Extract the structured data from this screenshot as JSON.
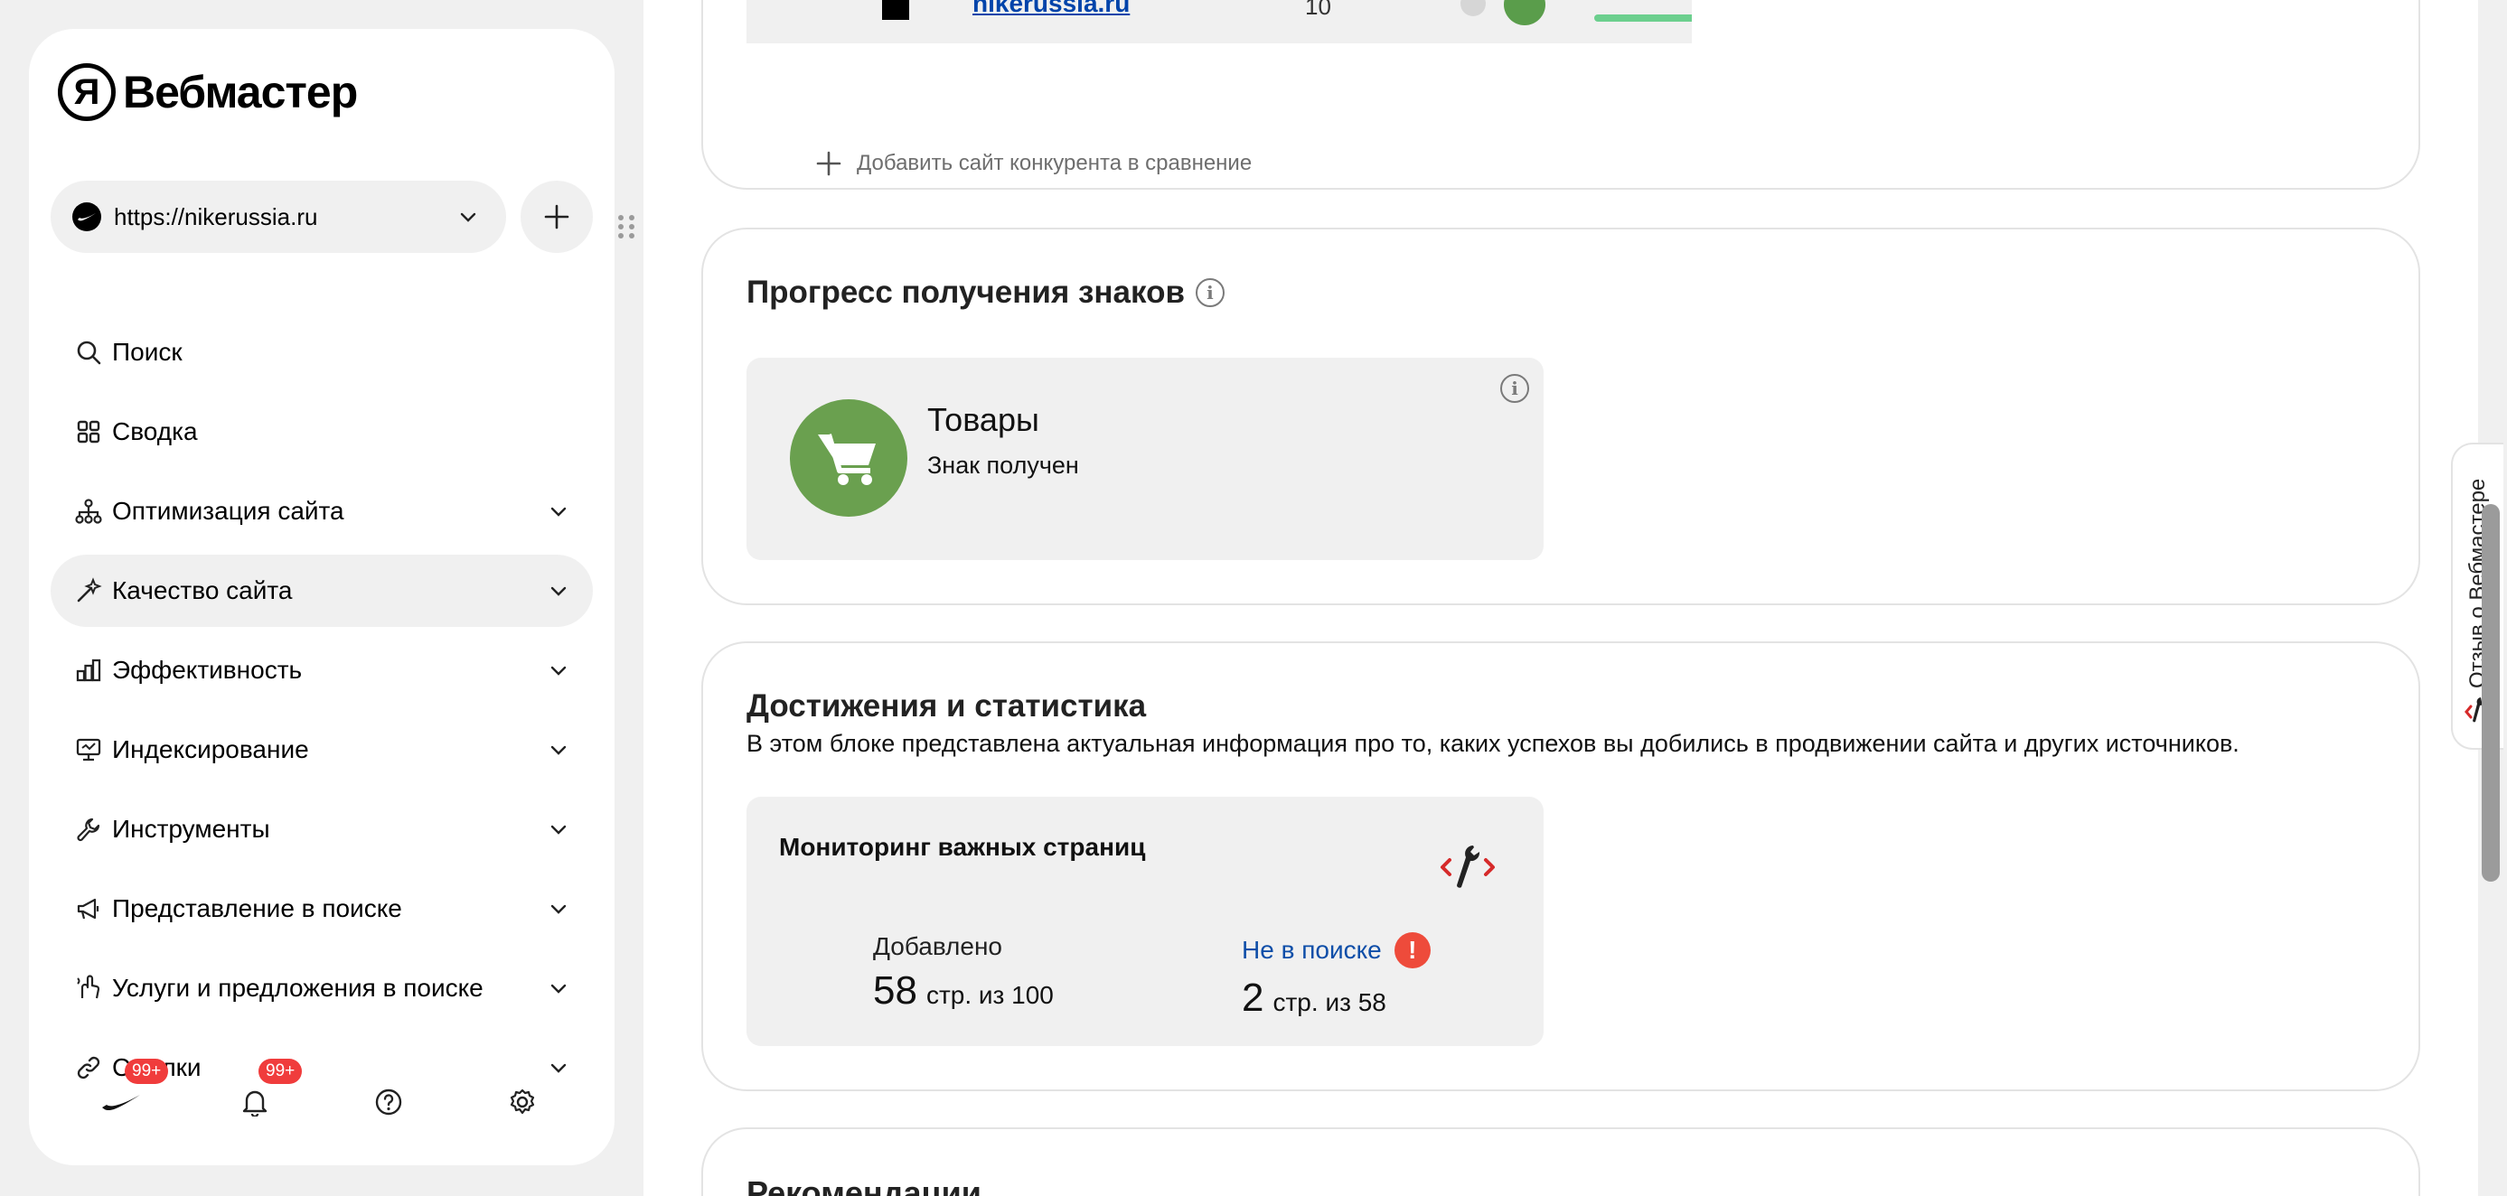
{
  "app": {
    "logo_letter": "Я",
    "title": "Вебмастер"
  },
  "site_selector": {
    "url": "https://nikerussia.ru"
  },
  "nav": {
    "items": [
      {
        "label": "Поиск"
      },
      {
        "label": "Сводка"
      },
      {
        "label": "Оптимизация сайта"
      },
      {
        "label": "Качество сайта"
      },
      {
        "label": "Эффективность"
      },
      {
        "label": "Индексирование"
      },
      {
        "label": "Инструменты"
      },
      {
        "label": "Представление в поиске"
      },
      {
        "label": "Услуги и предложения в поиске"
      },
      {
        "label": "Ссылки"
      }
    ]
  },
  "bottom_bar": {
    "sites_badge": "99+",
    "notifications_badge": "99+"
  },
  "competitors": {
    "row_domain": "nikerussia.ru",
    "row_value": "10",
    "add_label": "Добавить сайт конкурента в сравнение"
  },
  "badges_progress": {
    "title": "Прогресс получения знаков",
    "tile": {
      "title": "Товары",
      "status": "Знак получен"
    }
  },
  "achievements": {
    "title": "Достижения и статистика",
    "description": "В этом блоке представлена актуальная информация про то, каких успехов вы добились в продвижении сайта и других источников.",
    "monitoring": {
      "title": "Мониторинг важных страниц",
      "added_label": "Добавлено",
      "added_count": "58",
      "added_suffix": "стр. из 100",
      "not_in_search_label": "Не в поиске",
      "not_in_search_count": "2",
      "not_in_search_suffix": "стр. из 58"
    }
  },
  "recommendations": {
    "title": "Рекомендации"
  },
  "feedback": {
    "label": "Отзыв о Вебмастере"
  },
  "colors": {
    "page_bg": "#f0f0f0",
    "card_border": "#e3e3e3",
    "badge_green": "#6aa04f",
    "link_blue": "#0e4ea8",
    "alert_red": "#ee4b3b",
    "counter_red": "#f03c3c"
  },
  "icons": {
    "nav": [
      "search-icon",
      "grid-icon",
      "sitemap-icon",
      "magic-wand-icon",
      "chart-icon",
      "monitor-icon",
      "wrench-icon",
      "megaphone-icon",
      "hand-icon",
      "link-icon"
    ],
    "bottom": [
      "swoosh-icon",
      "bell-icon",
      "help-icon",
      "gear-icon"
    ]
  }
}
